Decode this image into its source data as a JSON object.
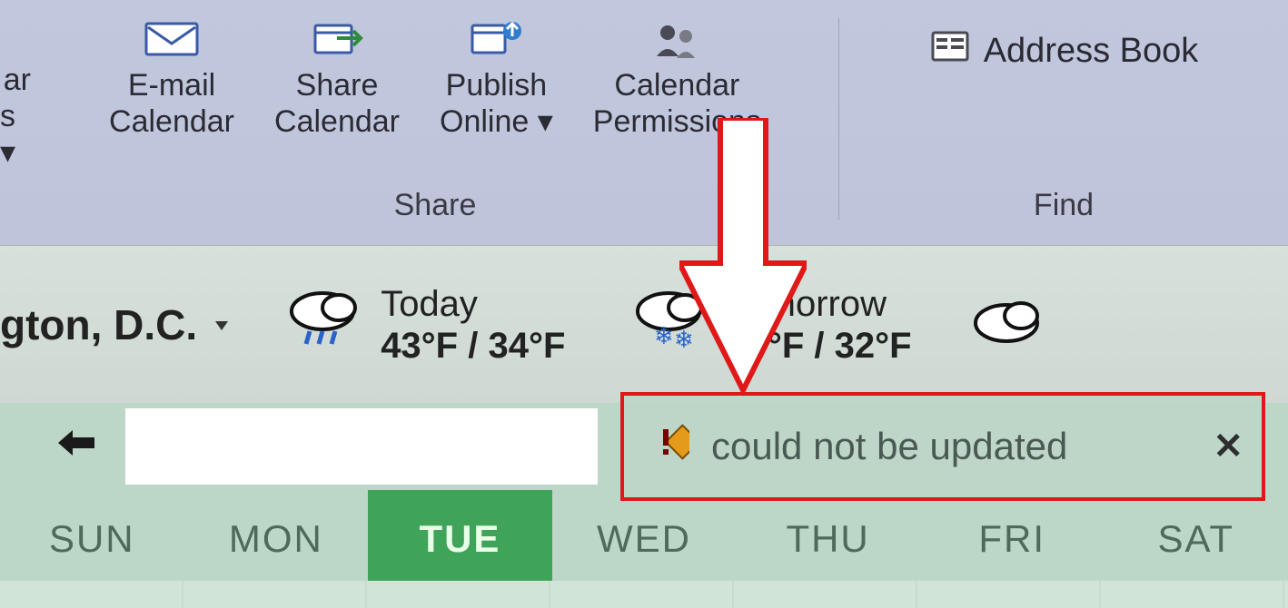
{
  "ribbon": {
    "left_clip": {
      "line1": "ar",
      "line2": "s ▾"
    },
    "btn_email": {
      "line1": "E-mail",
      "line2": "Calendar"
    },
    "btn_share": {
      "line1": "Share",
      "line2": "Calendar"
    },
    "btn_publish": {
      "line1": "Publish",
      "line2": "Online ▾"
    },
    "btn_perm": {
      "line1": "Calendar",
      "line2": "Permissions"
    },
    "group_share_label": "Share",
    "address_book_label": "Address Book",
    "group_find_label": "Find"
  },
  "weather": {
    "location": "gton, D.C.",
    "today": {
      "label": "Today",
      "hi_lo": "43°F / 34°F"
    },
    "tomorrow": {
      "label": "Tomorrow",
      "hi_lo": "37°F / 32°F"
    }
  },
  "calendar": {
    "warning_text": "could not be updated",
    "days": [
      "SUN",
      "MON",
      "TUE",
      "WED",
      "THU",
      "FRI",
      "SAT"
    ],
    "active_day_index": 2
  }
}
